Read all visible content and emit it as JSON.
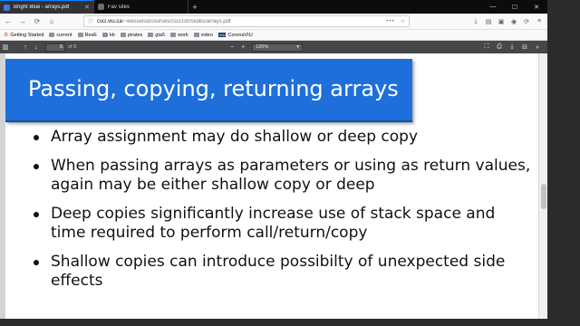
{
  "tabs": [
    {
      "label": "Bright Blue - arrays.pdf",
      "active": true,
      "favicon": "pdf-icon"
    },
    {
      "label": "Fav sites",
      "active": false,
      "favicon": "page-icon"
    }
  ],
  "newtab_glyph": "+",
  "window_controls": {
    "minimize": "—",
    "maximize": "☐",
    "close": "✕"
  },
  "nav": {
    "back": "←",
    "forward": "→",
    "reload": "⟳",
    "home": "⌂",
    "url_host": "csci.viu.ca",
    "url_path": "/~wesselsd/courses/csci330/slides/arrays.pdf",
    "url_dots": "•••",
    "bookmark_star": "☆",
    "right_icons": [
      "⤓",
      "▤",
      "▣",
      "◉",
      "⟳",
      "≡"
    ]
  },
  "bookmarks": [
    {
      "label": "Getting Started",
      "icon": "gear"
    },
    {
      "label": "current",
      "icon": "folder"
    },
    {
      "label": "ResE",
      "icon": "folder"
    },
    {
      "label": "kb",
      "icon": "folder"
    },
    {
      "label": "pirates",
      "icon": "folder"
    },
    {
      "label": "gta5",
      "icon": "folder"
    },
    {
      "label": "work",
      "icon": "folder"
    },
    {
      "label": "video",
      "icon": "folder"
    },
    {
      "label": "CoronaVIU",
      "icon": "viu",
      "badge": "VIU"
    }
  ],
  "pdf_toolbar": {
    "page": "5",
    "page_of": "of 8",
    "zoom": "120%",
    "zoom_out": "−",
    "zoom_in": "+"
  },
  "slide": {
    "title": "Passing, copying, returning arrays",
    "bullets": [
      "Array assignment may do shallow or deep copy",
      "When passing arrays as parameters or using as return values, again may be either shallow copy or deep",
      "Deep copies significantly increase use of stack space and time required to perform call/return/copy",
      "Shallow copies can introduce possibilty of unexpected side effects"
    ]
  },
  "colors": {
    "slide_title_bg": "#1e6fd9",
    "tab_accent": "#0a84ff"
  }
}
